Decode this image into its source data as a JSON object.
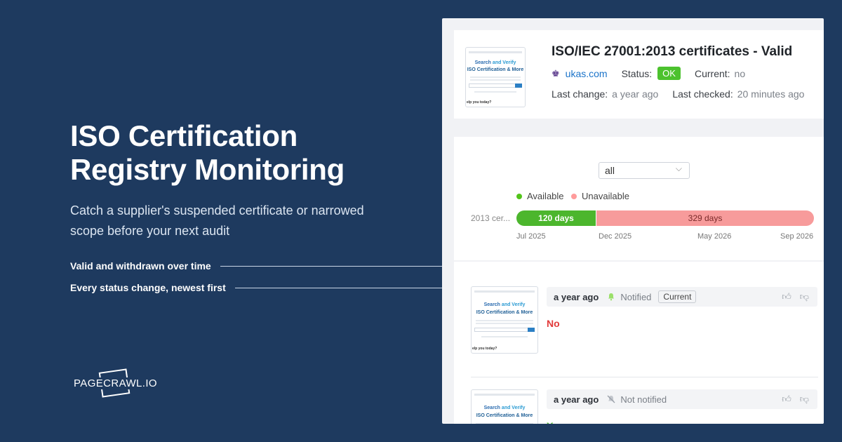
{
  "hero": {
    "title_line1": "ISO Certification",
    "title_line2": "Registry Monitoring",
    "subtitle": "Catch a supplier's suspended certificate or narrowed scope before your next audit"
  },
  "callouts": [
    {
      "label": "Valid and withdrawn over time"
    },
    {
      "label": "Every status change, newest first"
    }
  ],
  "brand": {
    "name": "PAGECRAWL.IO"
  },
  "monitor": {
    "title": "ISO/IEC 27001:2013 certificates - Valid",
    "domain": "ukas.com",
    "status_label": "Status:",
    "status_value": "OK",
    "current_label": "Current:",
    "current_value": "no",
    "last_change_label": "Last change:",
    "last_change_value": "a year ago",
    "last_checked_label": "Last checked:",
    "last_checked_value": "20 minutes ago",
    "thumbnail": {
      "line1_a": "Search",
      "line1_b": "and Verify",
      "line2_a": "ISO Certification",
      "line2_b": "& More",
      "help": "elp you today?"
    }
  },
  "timeline": {
    "filter_value": "all",
    "legend": [
      {
        "label": "Available",
        "color": "#52c41a"
      },
      {
        "label": "Unavailable",
        "color": "#ff8a8a"
      }
    ],
    "row_label": "2013 cer...",
    "segments": [
      {
        "label": "120 days",
        "days": 120,
        "status": "available"
      },
      {
        "label": "329 days",
        "days": 329,
        "status": "unavailable"
      }
    ],
    "ticks": [
      "Jul 2025",
      "Dec 2025",
      "May 2026",
      "Sep 2026"
    ]
  },
  "history": [
    {
      "ago": "a year ago",
      "notification": "Notified",
      "tag": "Current",
      "value": "No",
      "value_color": "#e23b3b"
    },
    {
      "ago": "a year ago",
      "notification": "Not notified",
      "tag": "",
      "value": "Y",
      "value_color": "#4cb62d"
    }
  ],
  "colors": {
    "background": "#1e3a5f",
    "accent_green": "#4cc22e",
    "unavailable": "#f79b9b"
  }
}
